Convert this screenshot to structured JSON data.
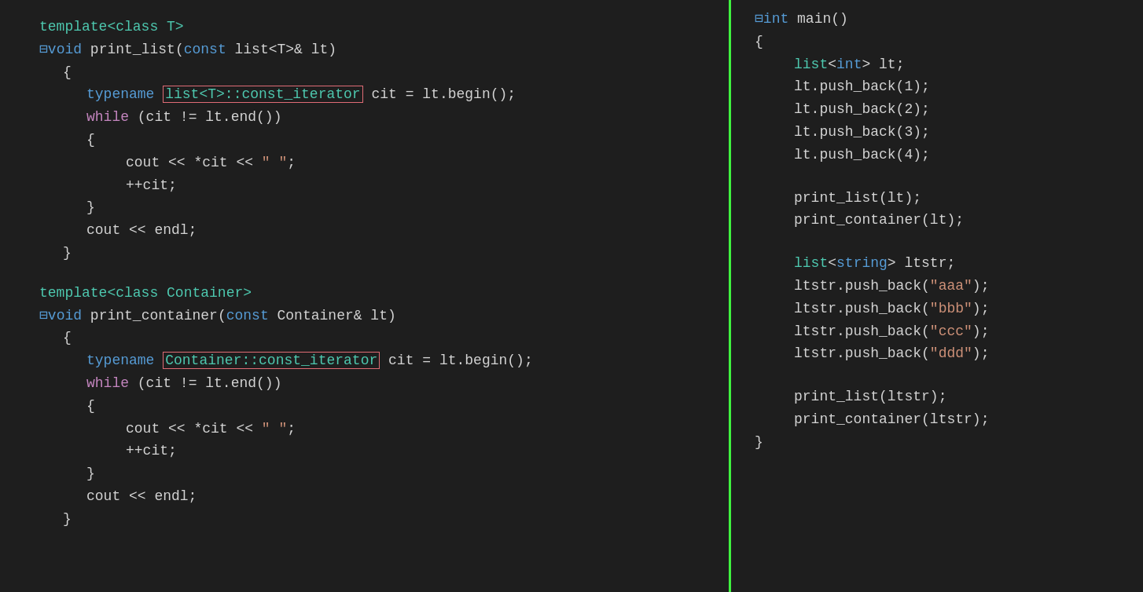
{
  "left": {
    "block1": {
      "lines": [
        {
          "indent": 0,
          "tokens": [
            {
              "t": "template<class T>",
              "c": "kw-teal"
            }
          ]
        },
        {
          "indent": 0,
          "tokens": [
            {
              "t": "⊟",
              "c": "minus"
            },
            {
              "t": "void",
              "c": "kw-blue"
            },
            {
              "t": " print_list(",
              "c": "plain"
            },
            {
              "t": "const",
              "c": "kw-blue"
            },
            {
              "t": " list<T>& lt)",
              "c": "plain"
            }
          ]
        },
        {
          "indent": 1,
          "tokens": [
            {
              "t": "{",
              "c": "plain"
            }
          ]
        },
        {
          "indent": 2,
          "tokens": [
            {
              "t": "typename ",
              "c": "kw-blue"
            },
            {
              "t": "list<T>::const_iterator",
              "c": "type-teal",
              "box": true
            },
            {
              "t": " cit = lt.begin();",
              "c": "plain"
            }
          ]
        },
        {
          "indent": 2,
          "tokens": [
            {
              "t": "while",
              "c": "kw-purple"
            },
            {
              "t": " (cit != lt.",
              "c": "plain"
            },
            {
              "t": "end",
              "c": "plain"
            },
            {
              "t": "())",
              "c": "plain"
            }
          ]
        },
        {
          "indent": 2,
          "tokens": [
            {
              "t": "{",
              "c": "plain"
            }
          ]
        },
        {
          "indent": 3,
          "tokens": [
            {
              "t": "cout",
              "c": "plain"
            },
            {
              "t": " << *cit << ",
              "c": "plain"
            },
            {
              "t": "\" \"",
              "c": "kw-orange"
            },
            {
              "t": ";",
              "c": "plain"
            }
          ]
        },
        {
          "indent": 3,
          "tokens": [
            {
              "t": "++cit;",
              "c": "plain"
            }
          ]
        },
        {
          "indent": 2,
          "tokens": [
            {
              "t": "}",
              "c": "plain"
            }
          ]
        },
        {
          "indent": 2,
          "tokens": [
            {
              "t": "cout",
              "c": "plain"
            },
            {
              "t": " << ",
              "c": "plain"
            },
            {
              "t": "endl",
              "c": "plain"
            },
            {
              "t": ";",
              "c": "plain"
            }
          ]
        },
        {
          "indent": 1,
          "tokens": [
            {
              "t": "}",
              "c": "plain"
            }
          ]
        }
      ]
    },
    "block2": {
      "lines": [
        {
          "indent": 0,
          "tokens": [
            {
              "t": "template<class Container>",
              "c": "kw-teal"
            }
          ]
        },
        {
          "indent": 0,
          "tokens": [
            {
              "t": "⊟",
              "c": "minus"
            },
            {
              "t": "void",
              "c": "kw-blue"
            },
            {
              "t": " print_container(",
              "c": "plain"
            },
            {
              "t": "const",
              "c": "kw-blue"
            },
            {
              "t": " Container& lt)",
              "c": "plain"
            }
          ]
        },
        {
          "indent": 1,
          "tokens": [
            {
              "t": "{",
              "c": "plain"
            }
          ]
        },
        {
          "indent": 2,
          "tokens": [
            {
              "t": "typename ",
              "c": "kw-blue"
            },
            {
              "t": "Container::const_iterator",
              "c": "type-teal",
              "box": true
            },
            {
              "t": " cit = lt.begin();",
              "c": "plain"
            }
          ]
        },
        {
          "indent": 2,
          "tokens": [
            {
              "t": "while",
              "c": "kw-purple"
            },
            {
              "t": " (cit != lt.",
              "c": "plain"
            },
            {
              "t": "end",
              "c": "plain"
            },
            {
              "t": "())",
              "c": "plain"
            }
          ]
        },
        {
          "indent": 2,
          "tokens": [
            {
              "t": "{",
              "c": "plain"
            }
          ]
        },
        {
          "indent": 3,
          "tokens": [
            {
              "t": "cout",
              "c": "plain"
            },
            {
              "t": " << *cit << ",
              "c": "plain"
            },
            {
              "t": "\" \"",
              "c": "kw-orange"
            },
            {
              "t": ";",
              "c": "plain"
            }
          ]
        },
        {
          "indent": 3,
          "tokens": [
            {
              "t": "++cit;",
              "c": "plain"
            }
          ]
        },
        {
          "indent": 2,
          "tokens": [
            {
              "t": "}",
              "c": "plain"
            }
          ]
        },
        {
          "indent": 2,
          "tokens": [
            {
              "t": "cout",
              "c": "plain"
            },
            {
              "t": " << ",
              "c": "plain"
            },
            {
              "t": "endl",
              "c": "plain"
            },
            {
              "t": ";",
              "c": "plain"
            }
          ]
        },
        {
          "indent": 1,
          "tokens": [
            {
              "t": "}",
              "c": "plain"
            }
          ]
        }
      ]
    }
  },
  "right": {
    "lines": [
      {
        "indent": 0,
        "tokens": [
          {
            "t": "⊟",
            "c": "minus"
          },
          {
            "t": "int",
            "c": "kw-blue"
          },
          {
            "t": " main()",
            "c": "plain"
          }
        ]
      },
      {
        "indent": 0,
        "tokens": [
          {
            "t": "{",
            "c": "plain"
          }
        ]
      },
      {
        "indent": 1,
        "tokens": [
          {
            "t": "list",
            "c": "type-teal"
          },
          {
            "t": "<",
            "c": "plain"
          },
          {
            "t": "int",
            "c": "kw-blue"
          },
          {
            "t": "> lt;",
            "c": "plain"
          }
        ]
      },
      {
        "indent": 1,
        "tokens": [
          {
            "t": "lt.push_back(1);",
            "c": "plain"
          }
        ]
      },
      {
        "indent": 1,
        "tokens": [
          {
            "t": "lt.push_back(2);",
            "c": "plain"
          }
        ]
      },
      {
        "indent": 1,
        "tokens": [
          {
            "t": "lt.push_back(3);",
            "c": "plain"
          }
        ]
      },
      {
        "indent": 1,
        "tokens": [
          {
            "t": "lt.push_back(4);",
            "c": "plain"
          }
        ]
      },
      {
        "indent": 0,
        "tokens": []
      },
      {
        "indent": 1,
        "tokens": [
          {
            "t": "print_list(lt);",
            "c": "plain"
          }
        ]
      },
      {
        "indent": 1,
        "tokens": [
          {
            "t": "print_container(lt);",
            "c": "plain"
          }
        ]
      },
      {
        "indent": 0,
        "tokens": []
      },
      {
        "indent": 1,
        "tokens": [
          {
            "t": "list",
            "c": "type-teal"
          },
          {
            "t": "<",
            "c": "plain"
          },
          {
            "t": "string",
            "c": "kw-blue"
          },
          {
            "t": "> ltstr;",
            "c": "plain"
          }
        ]
      },
      {
        "indent": 1,
        "tokens": [
          {
            "t": "ltstr.push_back(",
            "c": "plain"
          },
          {
            "t": "\"aaa\"",
            "c": "kw-orange"
          },
          {
            "t": ");",
            "c": "plain"
          }
        ]
      },
      {
        "indent": 1,
        "tokens": [
          {
            "t": "ltstr.push_back(",
            "c": "plain"
          },
          {
            "t": "\"bbb\"",
            "c": "kw-orange"
          },
          {
            "t": ");",
            "c": "plain"
          }
        ]
      },
      {
        "indent": 1,
        "tokens": [
          {
            "t": "ltstr.push_back(",
            "c": "plain"
          },
          {
            "t": "\"ccc\"",
            "c": "kw-orange"
          },
          {
            "t": ");",
            "c": "plain"
          }
        ]
      },
      {
        "indent": 1,
        "tokens": [
          {
            "t": "ltstr.push_back(",
            "c": "plain"
          },
          {
            "t": "\"ddd\"",
            "c": "kw-orange"
          },
          {
            "t": ");",
            "c": "plain"
          }
        ]
      },
      {
        "indent": 0,
        "tokens": []
      },
      {
        "indent": 1,
        "tokens": [
          {
            "t": "print_list(ltstr);",
            "c": "plain"
          }
        ]
      },
      {
        "indent": 1,
        "tokens": [
          {
            "t": "print_container(ltstr);",
            "c": "plain"
          }
        ]
      },
      {
        "indent": 0,
        "tokens": [
          {
            "t": "}",
            "c": "plain"
          }
        ]
      }
    ]
  }
}
